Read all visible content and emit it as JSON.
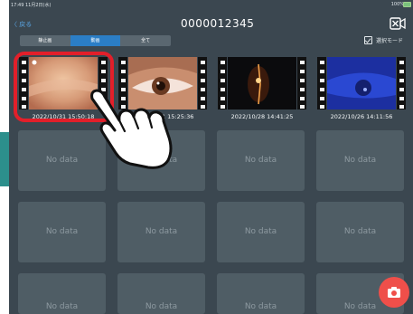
{
  "status_bar": {
    "time": "17:49  11月2日(水)",
    "battery": "100%"
  },
  "nav": {
    "back_label": "〈 戻る",
    "title": "0000012345"
  },
  "tabs": [
    {
      "label": "静止画",
      "active": false
    },
    {
      "label": "動画",
      "active": true
    },
    {
      "label": "全て",
      "active": false
    }
  ],
  "select_mode_label": "選択モード",
  "videos": [
    {
      "date": "2022/10/31 15:50:18",
      "selected": true
    },
    {
      "date": "2022/10/31 15:25:36",
      "selected": false
    },
    {
      "date": "2022/10/28 14:41:25",
      "selected": false
    },
    {
      "date": "2022/10/26 14:11:56",
      "selected": false
    }
  ],
  "empty_label": "No data",
  "colors": {
    "accent": "#2b7ec6",
    "selection": "#e21f2a",
    "fab": "#ef4f4a",
    "background": "#3b4750"
  },
  "icons": [
    "back-chevron-icon",
    "close-video-icon",
    "checkbox-icon",
    "camera-icon",
    "pointing-hand-icon"
  ]
}
